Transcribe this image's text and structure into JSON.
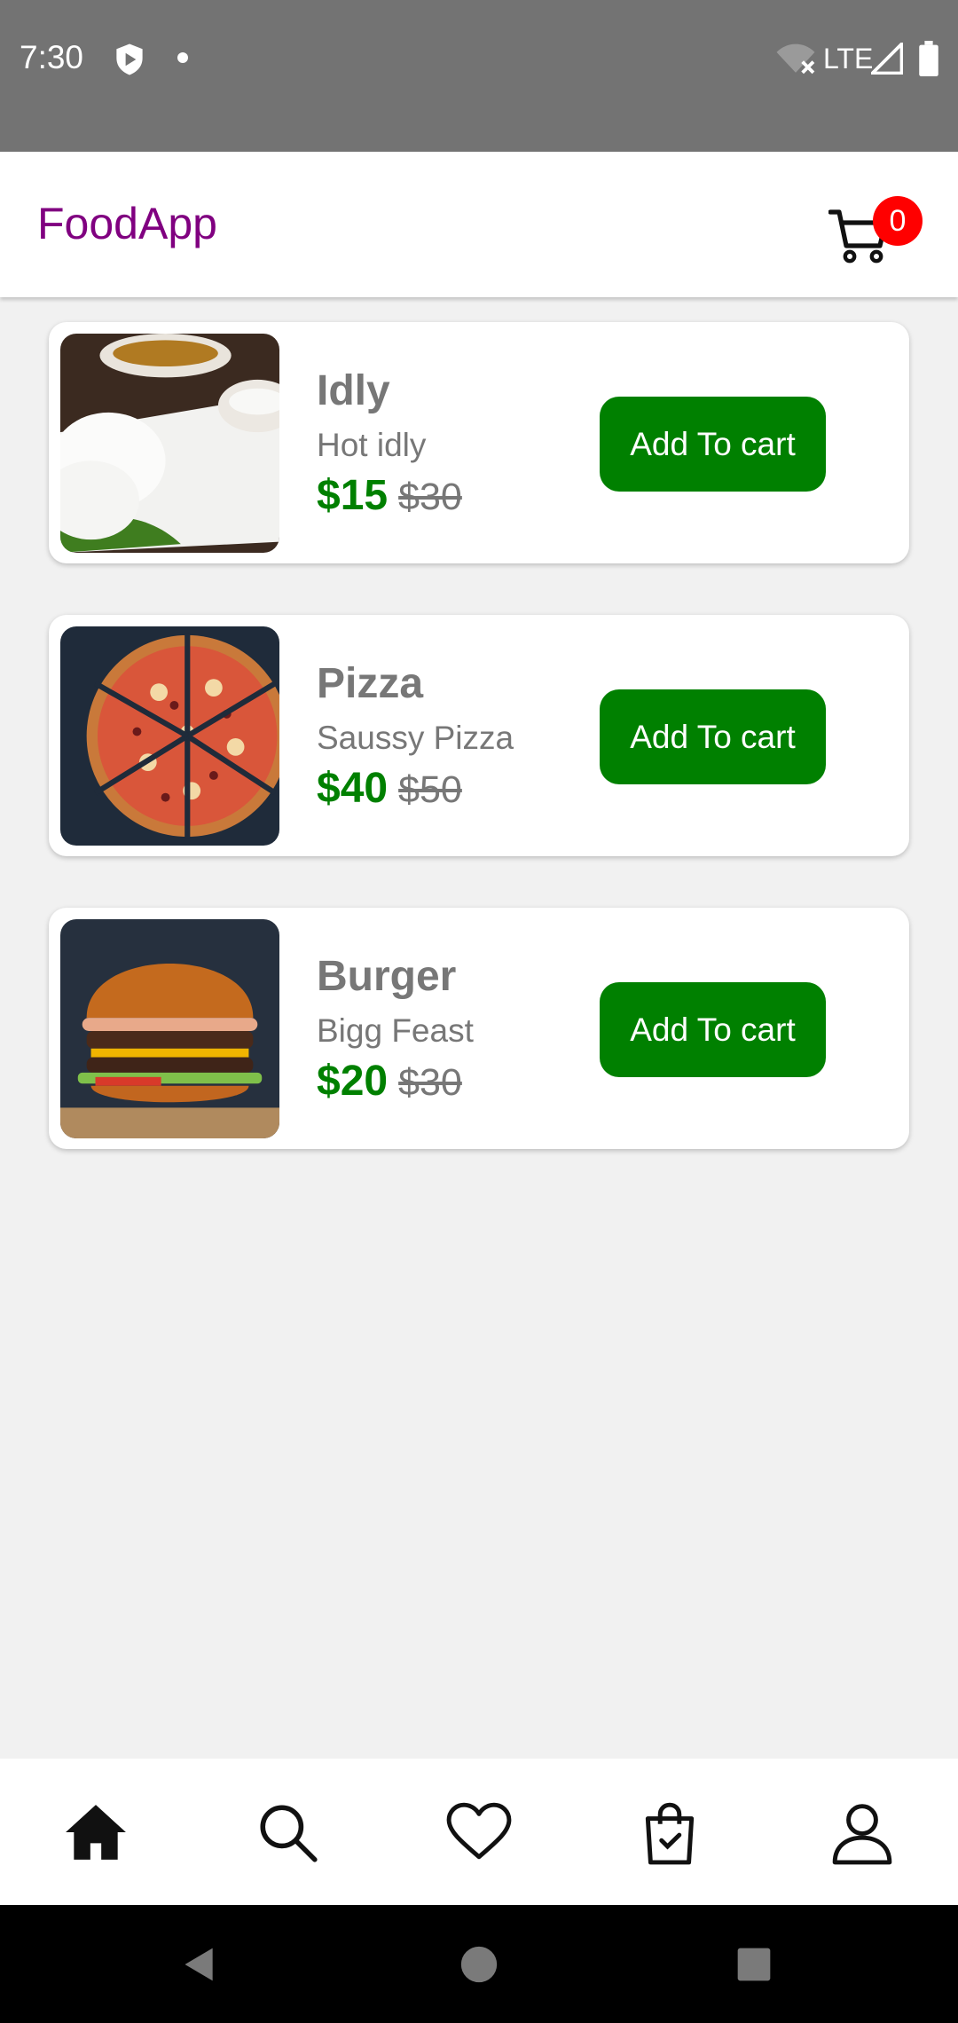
{
  "status_bar": {
    "time": "7:30",
    "network": "LTE",
    "icons": [
      "shield-icon",
      "notification-dot",
      "wifi-off-icon",
      "signal-icon",
      "battery-icon"
    ]
  },
  "app_bar": {
    "title": "FoodApp",
    "cart_count": "0",
    "icons": [
      "cart-icon"
    ]
  },
  "products": [
    {
      "name": "Idly",
      "description": "Hot idly",
      "price": "$15",
      "old_price": "$30",
      "button_label": "Add To cart",
      "image": "idly-photo"
    },
    {
      "name": "Pizza",
      "description": "Saussy Pizza",
      "price": "$40",
      "old_price": "$50",
      "button_label": "Add To cart",
      "image": "pizza-photo"
    },
    {
      "name": "Burger",
      "description": "Bigg Feast",
      "price": "$20",
      "old_price": "$30",
      "button_label": "Add To cart",
      "image": "burger-photo"
    }
  ],
  "bottom_nav": {
    "items": [
      "home-icon",
      "search-icon",
      "heart-icon",
      "shopping-bag-icon",
      "profile-icon"
    ],
    "active": "home-icon"
  },
  "colors": {
    "accent": "#800080",
    "button": "#008000",
    "price": "#008000",
    "badge": "#ff0000",
    "status_bar": "#737373"
  }
}
